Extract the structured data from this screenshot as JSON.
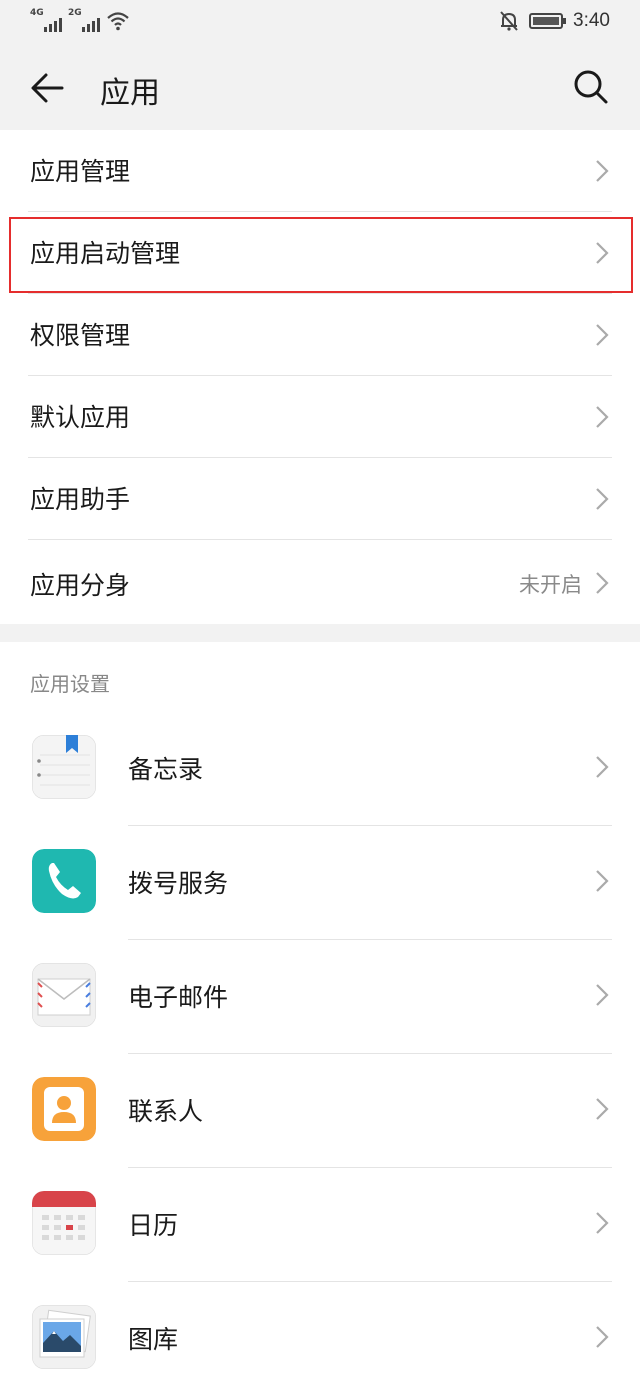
{
  "status_bar": {
    "network_1": "4G",
    "network_2": "2G",
    "time": "3:40"
  },
  "header": {
    "title": "应用"
  },
  "menu_items": [
    {
      "label": "应用管理",
      "value": ""
    },
    {
      "label": "应用启动管理",
      "value": "",
      "highlighted": true
    },
    {
      "label": "权限管理",
      "value": ""
    },
    {
      "label": "默认应用",
      "value": ""
    },
    {
      "label": "应用助手",
      "value": ""
    },
    {
      "label": "应用分身",
      "value": "未开启"
    }
  ],
  "app_settings": {
    "section_title": "应用设置",
    "apps": [
      {
        "label": "备忘录",
        "icon": "notepad-icon"
      },
      {
        "label": "拨号服务",
        "icon": "phone-icon"
      },
      {
        "label": "电子邮件",
        "icon": "email-icon"
      },
      {
        "label": "联系人",
        "icon": "contacts-icon"
      },
      {
        "label": "日历",
        "icon": "calendar-icon"
      },
      {
        "label": "图库",
        "icon": "gallery-icon"
      }
    ]
  },
  "colors": {
    "highlight_border": "#e52d2d",
    "phone_teal": "#1fb8b0",
    "contacts_orange": "#f7a23a",
    "calendar_red": "#d8444a",
    "notepad_bookmark": "#2d7fd8"
  }
}
